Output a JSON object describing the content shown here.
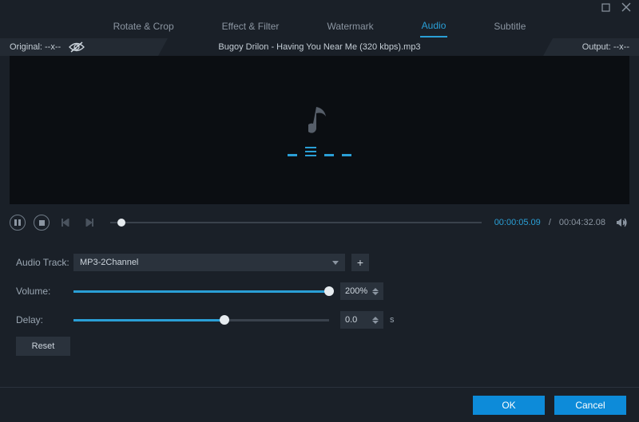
{
  "titlebar": {
    "maximize": "maximize",
    "close": "close"
  },
  "tabs": {
    "items": [
      {
        "label": "Rotate & Crop"
      },
      {
        "label": "Effect & Filter"
      },
      {
        "label": "Watermark"
      },
      {
        "label": "Audio"
      },
      {
        "label": "Subtitle"
      }
    ],
    "active_index": 3
  },
  "infobar": {
    "original_label": "Original: --x--",
    "title": "Bugoy Drilon - Having You Near Me (320 kbps).mp3",
    "output_label": "Output: --x--"
  },
  "playbar": {
    "current_time": "00:00:05.09",
    "separator": "/",
    "total_time": "00:04:32.08",
    "seek_percent": 1.9
  },
  "settings": {
    "audio_track": {
      "label": "Audio Track:",
      "value": "MP3-2Channel",
      "add": "+"
    },
    "volume": {
      "label": "Volume:",
      "value": "200%",
      "percent": 100
    },
    "delay": {
      "label": "Delay:",
      "value": "0.0",
      "unit": "s",
      "percent": 59
    },
    "reset": "Reset"
  },
  "footer": {
    "ok": "OK",
    "cancel": "Cancel"
  },
  "colors": {
    "accent": "#2a9fd6",
    "bg": "#1a2028",
    "panel": "#2a323c"
  }
}
